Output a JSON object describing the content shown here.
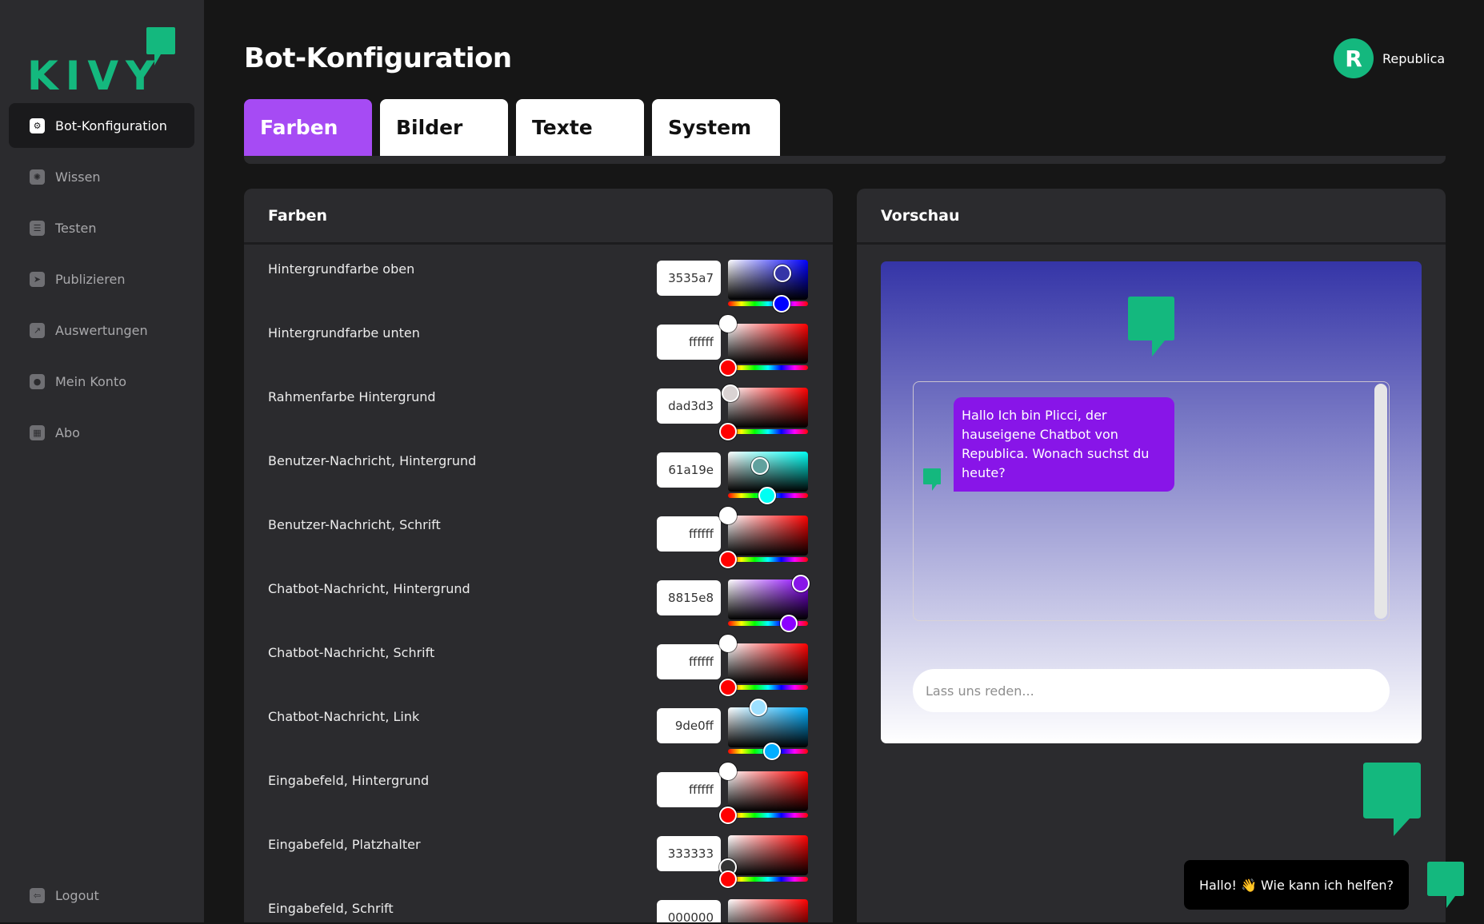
{
  "app": {
    "logo_text": "KIVY",
    "brand_color": "#14b87e",
    "accent_color": "#a64bf4"
  },
  "sidebar": {
    "items": [
      {
        "label": "Bot-Konfiguration",
        "icon": "gear-icon",
        "active": true
      },
      {
        "label": "Wissen",
        "icon": "lightbulb-icon",
        "active": false
      },
      {
        "label": "Testen",
        "icon": "checklist-icon",
        "active": false
      },
      {
        "label": "Publizieren",
        "icon": "send-icon",
        "active": false
      },
      {
        "label": "Auswertungen",
        "icon": "chart-icon",
        "active": false
      },
      {
        "label": "Mein Konto",
        "icon": "user-icon",
        "active": false
      },
      {
        "label": "Abo",
        "icon": "calendar-icon",
        "active": false
      }
    ],
    "logout": {
      "label": "Logout",
      "icon": "logout-icon"
    }
  },
  "header": {
    "title": "Bot-Konfiguration",
    "user": {
      "initial": "R",
      "name": "Republica"
    }
  },
  "tabs": [
    {
      "label": "Farben",
      "active": true
    },
    {
      "label": "Bilder",
      "active": false
    },
    {
      "label": "Texte",
      "active": false
    },
    {
      "label": "System",
      "active": false
    }
  ],
  "colors_panel": {
    "title": "Farben",
    "rows": [
      {
        "label": "Hintergrundfarbe oben",
        "value": "3535a7"
      },
      {
        "label": "Hintergrundfarbe unten",
        "value": "ffffff"
      },
      {
        "label": "Rahmenfarbe Hintergrund",
        "value": "dad3d3"
      },
      {
        "label": "Benutzer-Nachricht, Hintergrund",
        "value": "61a19e"
      },
      {
        "label": "Benutzer-Nachricht, Schrift",
        "value": "ffffff"
      },
      {
        "label": "Chatbot-Nachricht, Hintergrund",
        "value": "8815e8"
      },
      {
        "label": "Chatbot-Nachricht, Schrift",
        "value": "ffffff"
      },
      {
        "label": "Chatbot-Nachricht, Link",
        "value": "9de0ff"
      },
      {
        "label": "Eingabefeld, Hintergrund",
        "value": "ffffff"
      },
      {
        "label": "Eingabefeld, Platzhalter",
        "value": "333333"
      },
      {
        "label": "Eingabefeld, Schrift",
        "value": "000000"
      }
    ]
  },
  "preview_panel": {
    "title": "Vorschau",
    "bot_message": "Hallo Ich bin Plicci, der hauseigene Chatbot von Republica. Wonach suchst du heute?",
    "input_placeholder": "Lass uns reden...",
    "greeting": "Hallo! 👋 Wie kann ich helfen?"
  }
}
